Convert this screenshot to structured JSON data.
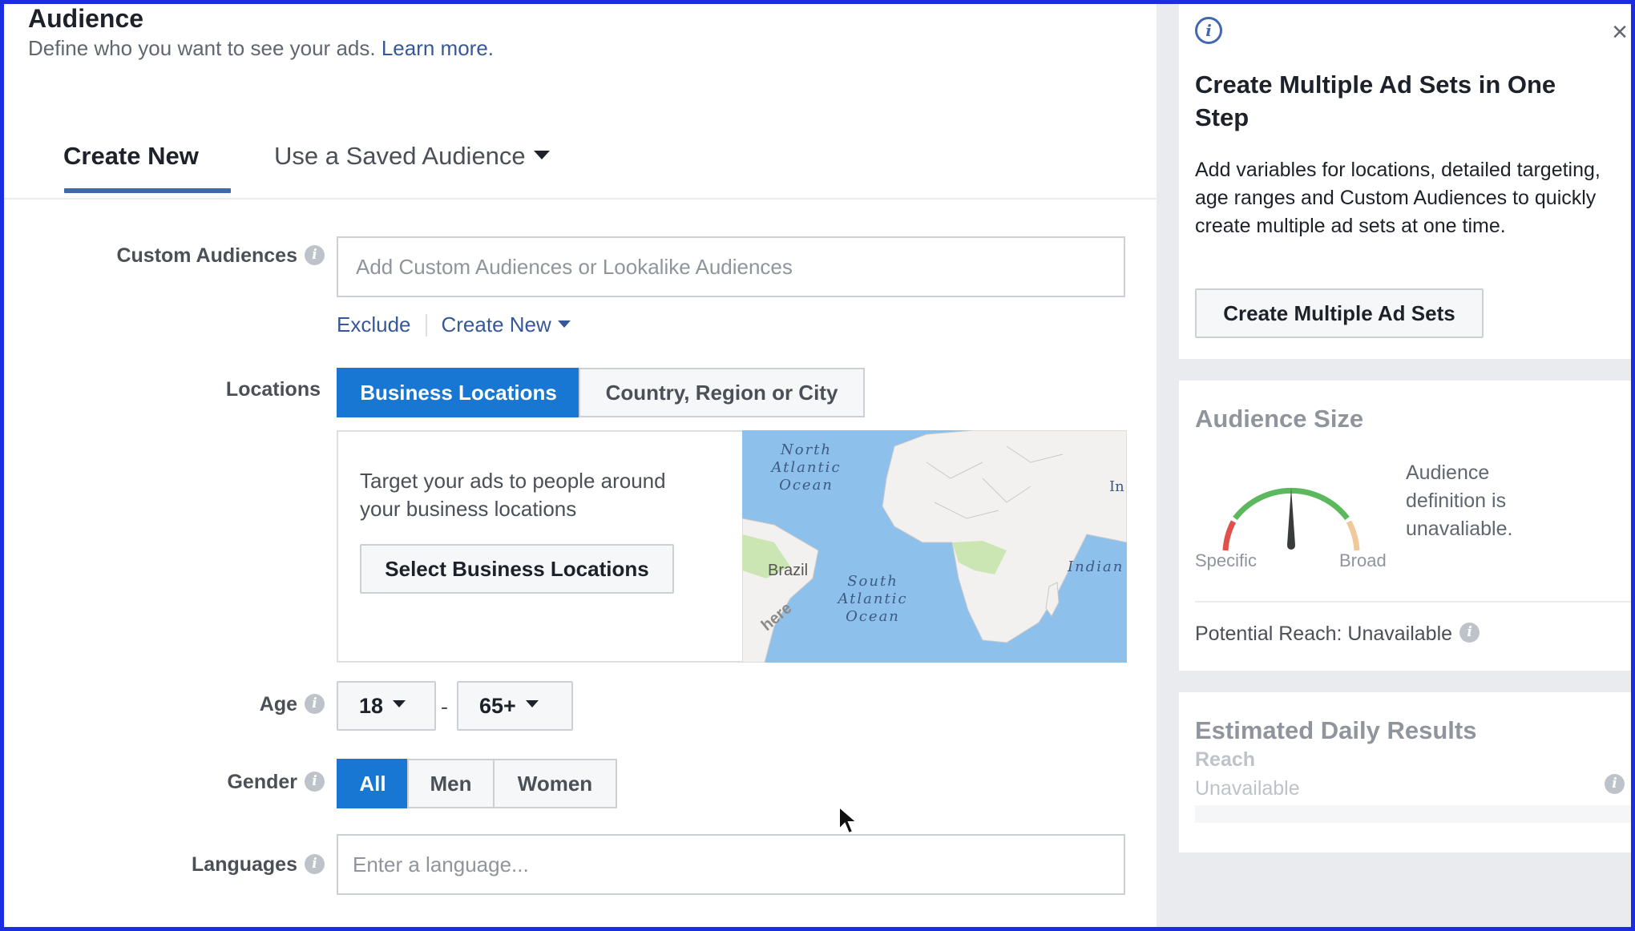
{
  "audience": {
    "title": "Audience",
    "subtitle": "Define who you want to see your ads.",
    "learn_more": "Learn more."
  },
  "tabs": {
    "create_new": "Create New",
    "saved_audience": "Use a Saved Audience"
  },
  "custom_audiences": {
    "label": "Custom Audiences",
    "placeholder": "Add Custom Audiences or Lookalike Audiences",
    "exclude": "Exclude",
    "create_new": "Create New"
  },
  "locations": {
    "label": "Locations",
    "options": [
      "Business Locations",
      "Country, Region or City"
    ],
    "selected": "Business Locations",
    "description": "Target your ads to people around your business locations",
    "select_button": "Select Business Locations",
    "map_labels": {
      "north_atlantic": "North Atlantic Ocean",
      "south_atlantic": "South Atlantic Ocean",
      "brazil": "Brazil",
      "indian": "Indian",
      "in": "In",
      "watermark": "here"
    }
  },
  "age": {
    "label": "Age",
    "min": "18",
    "separator": "-",
    "max": "65+"
  },
  "gender": {
    "label": "Gender",
    "options": [
      "All",
      "Men",
      "Women"
    ],
    "selected": "All"
  },
  "languages": {
    "label": "Languages",
    "placeholder": "Enter a language..."
  },
  "tip": {
    "title": "Create Multiple Ad Sets in One Step",
    "body": "Add variables for locations, detailed targeting, age ranges and Custom Audiences to quickly create multiple ad sets at one time.",
    "button": "Create Multiple Ad Sets",
    "close_icon": "close-icon"
  },
  "audience_size": {
    "title": "Audience Size",
    "specific": "Specific",
    "broad": "Broad",
    "description": "Audience definition is unavaliable.",
    "potential_reach": "Potential Reach: Unavailable"
  },
  "estimated": {
    "title": "Estimated Daily Results",
    "reach_label": "Reach",
    "reach_value": "Unavailable"
  },
  "colors": {
    "accent": "#1877d3",
    "link": "#365899",
    "tab_underline": "#4267b2",
    "frame": "#1a2de0",
    "gauge_red": "#e0514b",
    "gauge_green": "#5cb85c",
    "gauge_orange": "#f0c89a"
  }
}
